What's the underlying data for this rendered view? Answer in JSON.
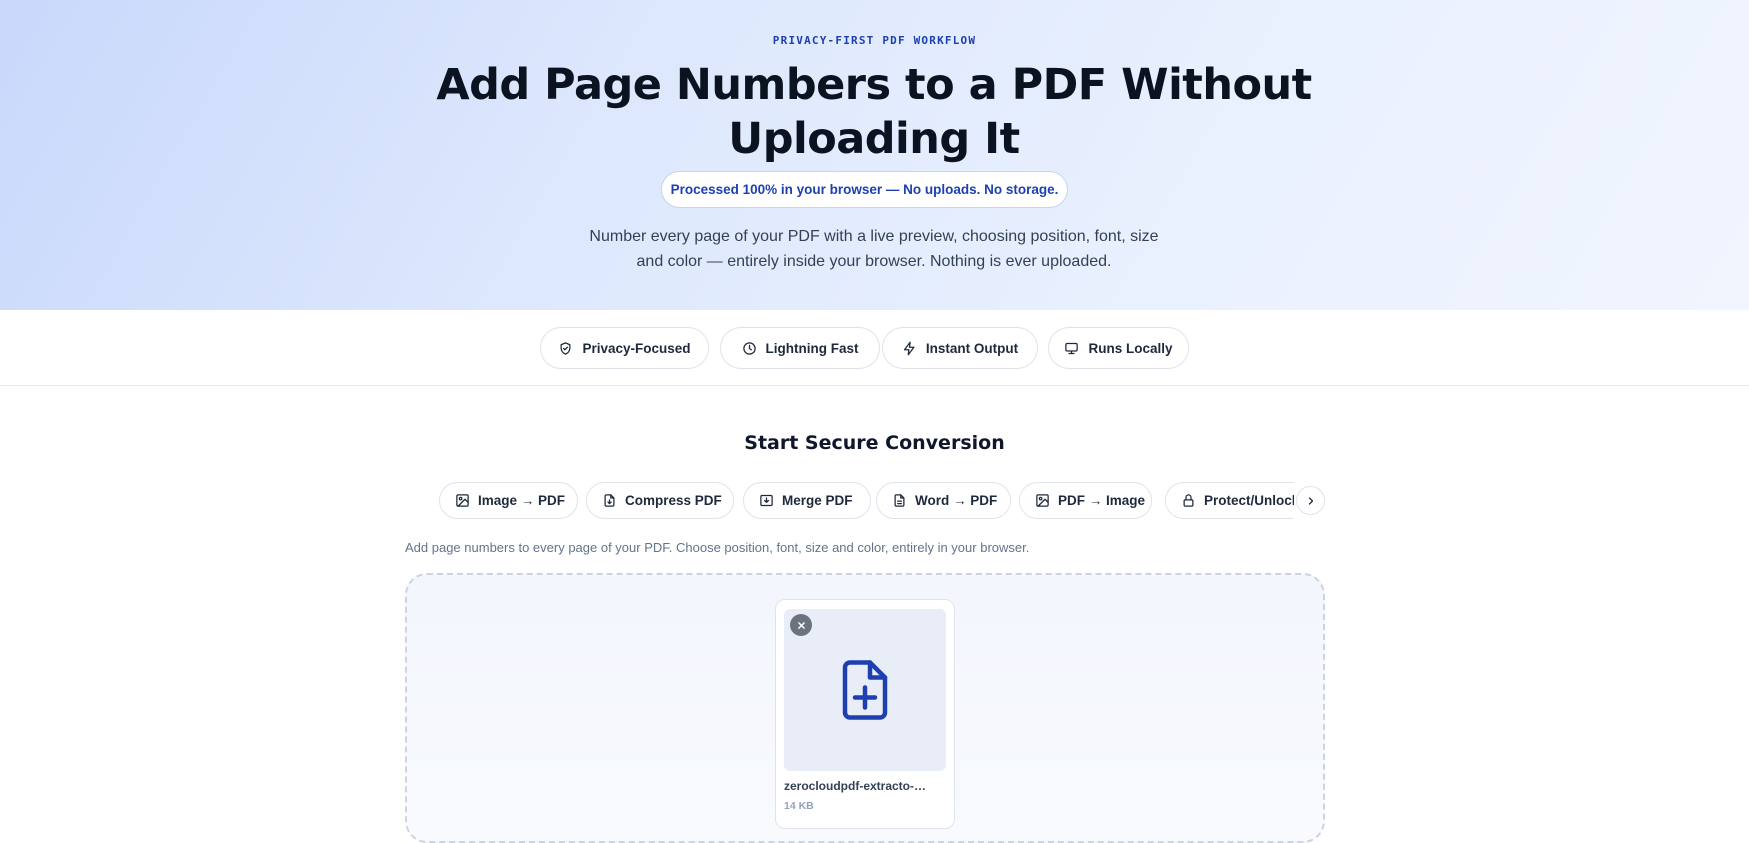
{
  "hero": {
    "eyebrow": "PRIVACY-FIRST PDF WORKFLOW",
    "title": "Add Page Numbers to a PDF Without Uploading It",
    "privacy_pill": "Processed 100% in your browser — No uploads. No storage.",
    "description": "Number every page of your PDF with a live preview, choosing position, font, size and color — entirely inside your browser. Nothing is ever uploaded."
  },
  "features": [
    {
      "label": "Privacy-Focused",
      "icon": "shield-check-icon"
    },
    {
      "label": "Lightning Fast",
      "icon": "clock-icon"
    },
    {
      "label": "Instant Output",
      "icon": "lightning-icon"
    },
    {
      "label": "Runs Locally",
      "icon": "monitor-icon"
    }
  ],
  "converter": {
    "title": "Start Secure Conversion",
    "tools": [
      {
        "label": "Image → PDF",
        "icon": "image-icon"
      },
      {
        "label": "Compress PDF",
        "icon": "file-compress-icon"
      },
      {
        "label": "Merge PDF",
        "icon": "merge-icon"
      },
      {
        "label": "Word → PDF",
        "icon": "document-icon"
      },
      {
        "label": "PDF → Image",
        "icon": "image-icon"
      },
      {
        "label": "Protect/Unlock",
        "icon": "lock-icon"
      }
    ],
    "helper_text": "Add page numbers to every page of your PDF. Choose position, font, size and color, entirely in your browser.",
    "file": {
      "name": "zerocloudpdf-extracto-…",
      "size": "14 KB",
      "icon": "file-plus-icon"
    }
  },
  "colors": {
    "accent": "#1e40af",
    "hero_bg_start": "#c9d8fb",
    "hero_bg_end": "#f1f5fe",
    "text_dark": "#0f172a"
  }
}
